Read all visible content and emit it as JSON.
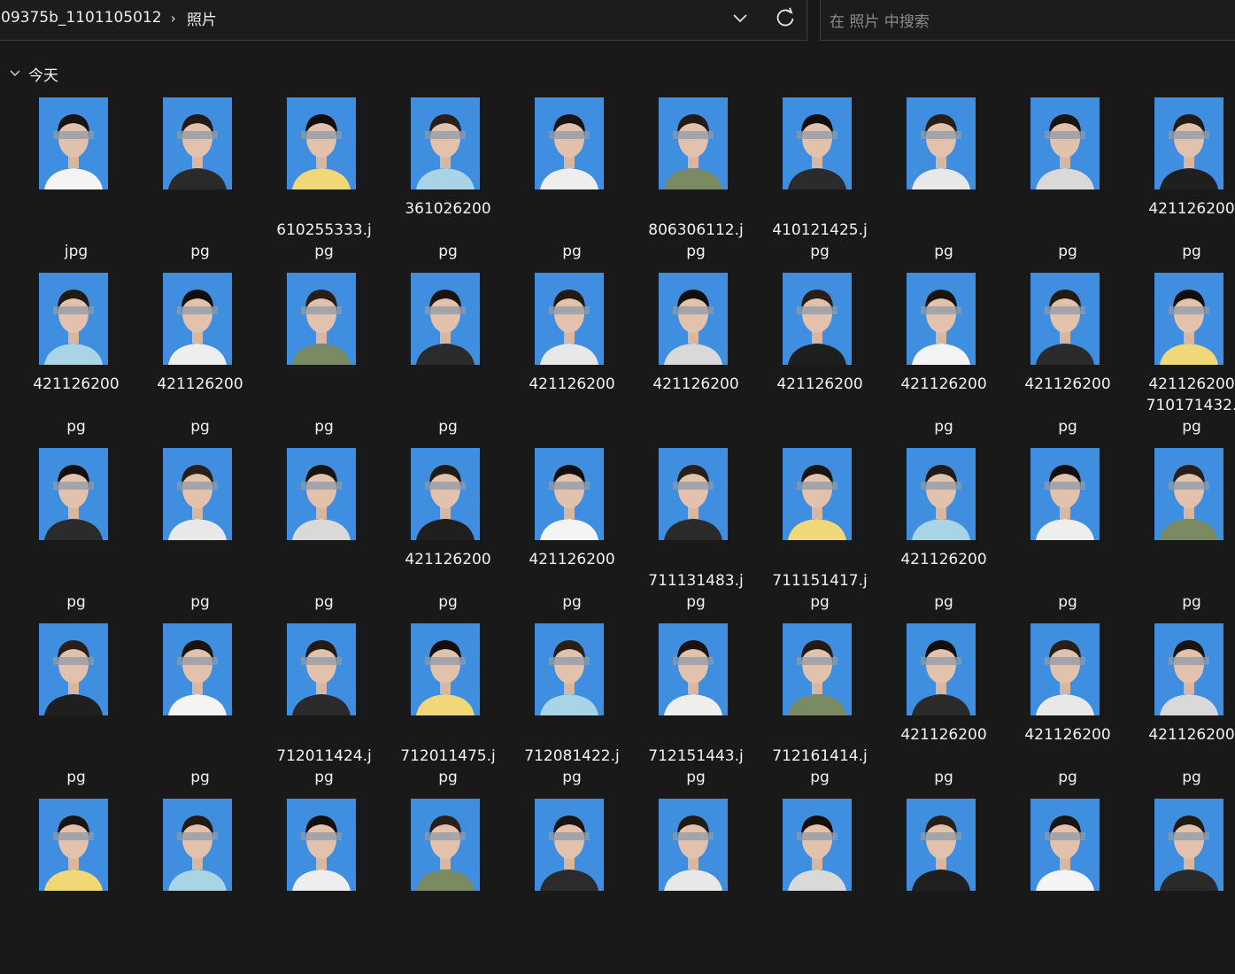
{
  "address_bar": {
    "folder": "09375b_1101105012",
    "separator": "›",
    "current": "照片"
  },
  "search": {
    "placeholder": "在 照片 中搜索"
  },
  "group": {
    "label": "今天"
  },
  "colors": {
    "thumb_bg": "#3f8ee0",
    "window_bg": "#191919"
  },
  "rows": [
    [
      {
        "l1": "",
        "l2": "",
        "l3": "jpg"
      },
      {
        "l1": "",
        "l2": "",
        "l3": "pg"
      },
      {
        "l1": "",
        "l2": "610255333.j",
        "l3": "pg"
      },
      {
        "l1": "361026200",
        "l2": "",
        "l3": "pg"
      },
      {
        "l1": "",
        "l2": "",
        "l3": "pg"
      },
      {
        "l1": "",
        "l2": "806306112.j",
        "l3": "pg"
      },
      {
        "l1": "",
        "l2": "410121425.j",
        "l3": "pg"
      },
      {
        "l1": "",
        "l2": "",
        "l3": "pg"
      },
      {
        "l1": "",
        "l2": "",
        "l3": "pg"
      },
      {
        "l1": "421126200",
        "l2": "",
        "l3": "pg"
      }
    ],
    [
      {
        "l1": "421126200",
        "l2": "",
        "l3": "pg"
      },
      {
        "l1": "421126200",
        "l2": "",
        "l3": "pg"
      },
      {
        "l1": "",
        "l2": "",
        "l3": "pg"
      },
      {
        "l1": "",
        "l2": "",
        "l3": "pg"
      },
      {
        "l1": "421126200",
        "l2": "",
        "l3": ""
      },
      {
        "l1": "421126200",
        "l2": "",
        "l3": ""
      },
      {
        "l1": "421126200",
        "l2": "",
        "l3": ""
      },
      {
        "l1": "421126200",
        "l2": "",
        "l3": "pg"
      },
      {
        "l1": "421126200",
        "l2": "",
        "l3": "pg"
      },
      {
        "l1": "421126200",
        "l2": "710171432.",
        "l3": "pg"
      }
    ],
    [
      {
        "l1": "",
        "l2": "",
        "l3": "pg"
      },
      {
        "l1": "",
        "l2": "",
        "l3": "pg"
      },
      {
        "l1": "",
        "l2": "",
        "l3": "pg"
      },
      {
        "l1": "421126200",
        "l2": "",
        "l3": "pg"
      },
      {
        "l1": "421126200",
        "l2": "",
        "l3": "pg"
      },
      {
        "l1": "",
        "l2": "711131483.j",
        "l3": "pg"
      },
      {
        "l1": "",
        "l2": "711151417.j",
        "l3": "pg"
      },
      {
        "l1": "421126200",
        "l2": "",
        "l3": "pg"
      },
      {
        "l1": "",
        "l2": "",
        "l3": "pg"
      },
      {
        "l1": "",
        "l2": "",
        "l3": "pg"
      }
    ],
    [
      {
        "l1": "",
        "l2": "",
        "l3": "pg"
      },
      {
        "l1": "",
        "l2": "",
        "l3": "pg"
      },
      {
        "l1": "",
        "l2": "712011424.j",
        "l3": "pg"
      },
      {
        "l1": "",
        "l2": "712011475.j",
        "l3": "pg"
      },
      {
        "l1": "",
        "l2": "712081422.j",
        "l3": "pg"
      },
      {
        "l1": "",
        "l2": "712151443.j",
        "l3": "pg"
      },
      {
        "l1": "",
        "l2": "712161414.j",
        "l3": "pg"
      },
      {
        "l1": "421126200",
        "l2": "",
        "l3": "pg"
      },
      {
        "l1": "421126200",
        "l2": "",
        "l3": "pg"
      },
      {
        "l1": "421126200",
        "l2": "",
        "l3": "pg"
      }
    ],
    [
      {
        "l1": "",
        "l2": "",
        "l3": ""
      },
      {
        "l1": "",
        "l2": "",
        "l3": ""
      },
      {
        "l1": "",
        "l2": "",
        "l3": ""
      },
      {
        "l1": "",
        "l2": "",
        "l3": ""
      },
      {
        "l1": "",
        "l2": "",
        "l3": ""
      },
      {
        "l1": "",
        "l2": "",
        "l3": ""
      },
      {
        "l1": "",
        "l2": "",
        "l3": ""
      },
      {
        "l1": "",
        "l2": "",
        "l3": ""
      },
      {
        "l1": "",
        "l2": "",
        "l3": ""
      },
      {
        "l1": "",
        "l2": "",
        "l3": ""
      }
    ]
  ]
}
